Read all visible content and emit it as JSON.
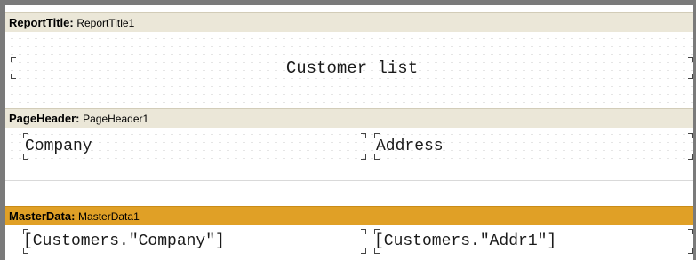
{
  "report_title_band": {
    "name": "ReportTitle",
    "value": "ReportTitle1"
  },
  "report_title_text": "Customer list",
  "page_header_band": {
    "name": "PageHeader",
    "value": "PageHeader1"
  },
  "page_header_fields": [
    "Company",
    "Address"
  ],
  "master_data_band": {
    "name": "MasterData",
    "value": "MasterData1"
  },
  "master_data_fields": [
    "[Customers.\"Company\"]",
    "[Customers.\"Addr1\"]"
  ],
  "colors": {
    "band_header": "#ebe7d8",
    "master_data_header": "#e0a026"
  }
}
